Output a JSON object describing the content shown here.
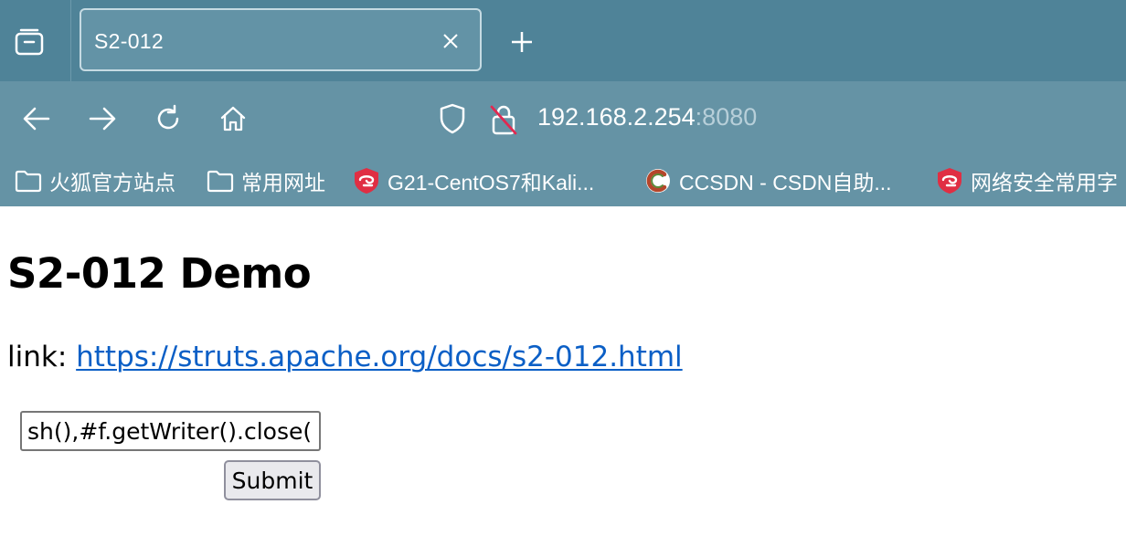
{
  "browser": {
    "tab": {
      "title": "S2-012"
    },
    "address": {
      "host": "192.168.2.254",
      "port": ":8080"
    },
    "bookmarks": [
      {
        "label": "火狐官方站点",
        "icon": "folder-icon"
      },
      {
        "label": "常用网址",
        "icon": "folder-icon"
      },
      {
        "label": "G21-CentOS7和Kali...",
        "icon": "shield-favicon-icon"
      },
      {
        "label": "CCSDN - CSDN自助...",
        "icon": "c-favicon-icon"
      },
      {
        "label": "网络安全常用字",
        "icon": "shield-favicon-icon"
      }
    ]
  },
  "page": {
    "heading": "S2-012 Demo",
    "link_prefix": "link: ",
    "link_text": "https://struts.apache.org/docs/s2-012.html",
    "payload_value": "sh(),#f.getWriter().close()}",
    "submit_label": "Submit"
  },
  "colors": {
    "tabstrip": "#4f8398",
    "toolbar": "#6593a5",
    "link": "#0b5fc6"
  }
}
